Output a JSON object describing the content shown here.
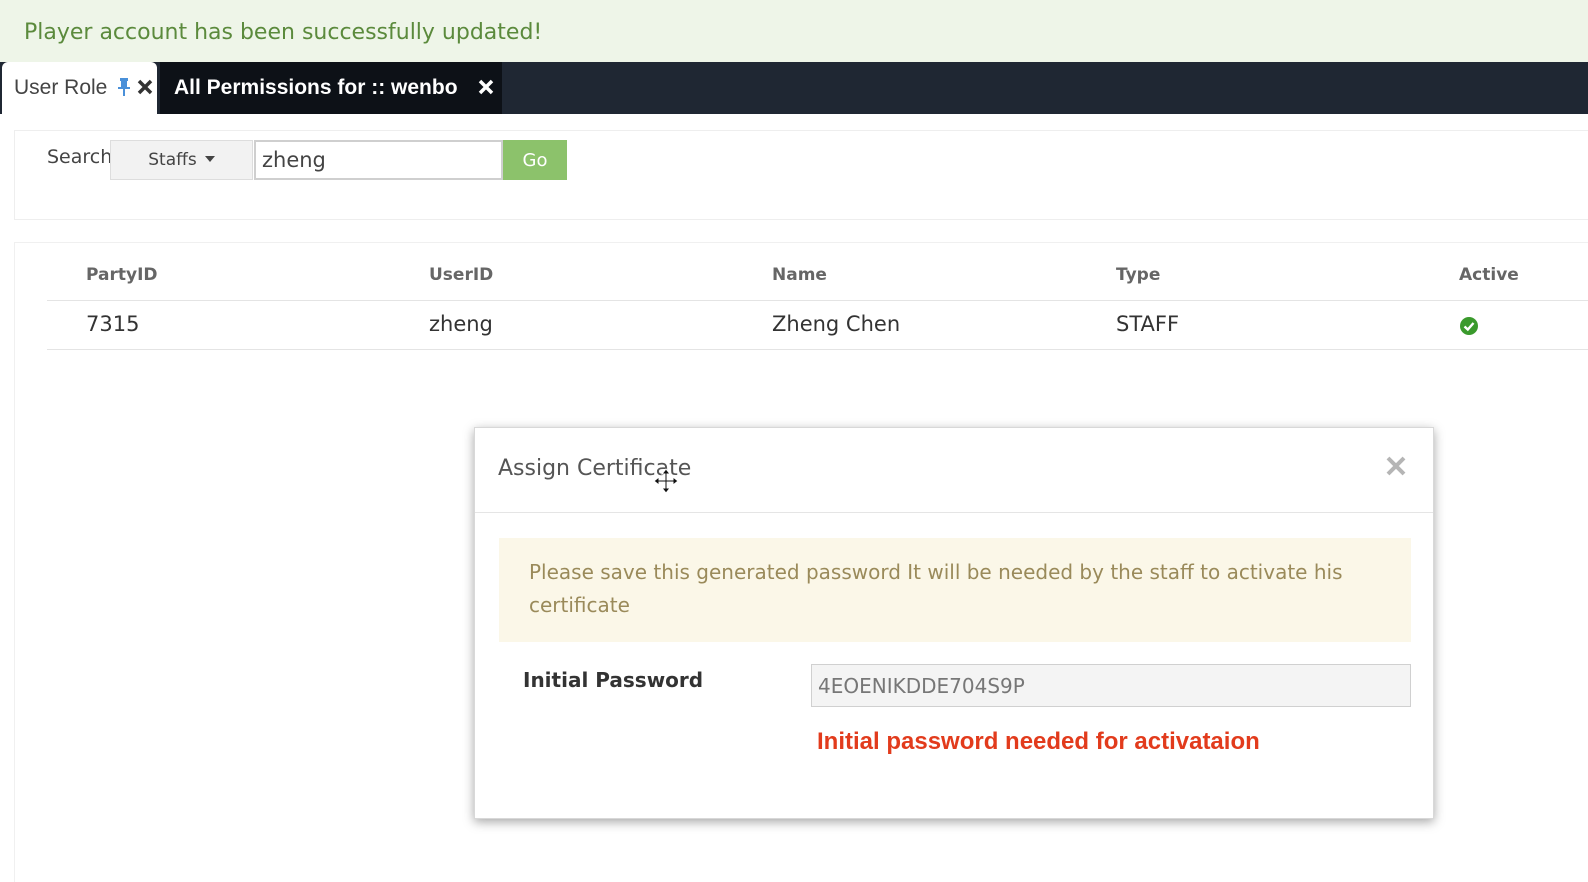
{
  "notification": {
    "text": "Player account has been successfully updated!"
  },
  "tabs": [
    {
      "label": "User Role",
      "active": true
    },
    {
      "label": "All Permissions for :: wenbo",
      "active": false
    }
  ],
  "search": {
    "label": "Search",
    "scope": "Staffs",
    "value": "zheng",
    "go_label": "Go"
  },
  "table": {
    "columns": [
      "PartyID",
      "UserID",
      "Name",
      "Type",
      "Active"
    ],
    "rows": [
      {
        "party_id": "7315",
        "user_id": "zheng",
        "name": "Zheng Chen",
        "type": "STAFF",
        "active": true
      }
    ]
  },
  "modal": {
    "title": "Assign Certificate",
    "warning": "Please save this generated password It will be needed by the staff to activate his certificate",
    "password_label": "Initial Password",
    "password_value": "4EOENIKDDE704S9P",
    "annotation": "Initial password needed for activataion"
  },
  "colors": {
    "success_bg": "#eef5e8",
    "tabbar_bg": "#1f2733",
    "go_button": "#8cc26b",
    "annotation_red": "#e23b1c",
    "active_check": "#3a9a2c"
  },
  "icons": {
    "pin": "pin-icon",
    "tab_close": "close-icon",
    "dropdown": "caret-down-icon",
    "active": "check-circle-icon",
    "move": "move-cursor-icon",
    "modal_close": "close-icon"
  }
}
